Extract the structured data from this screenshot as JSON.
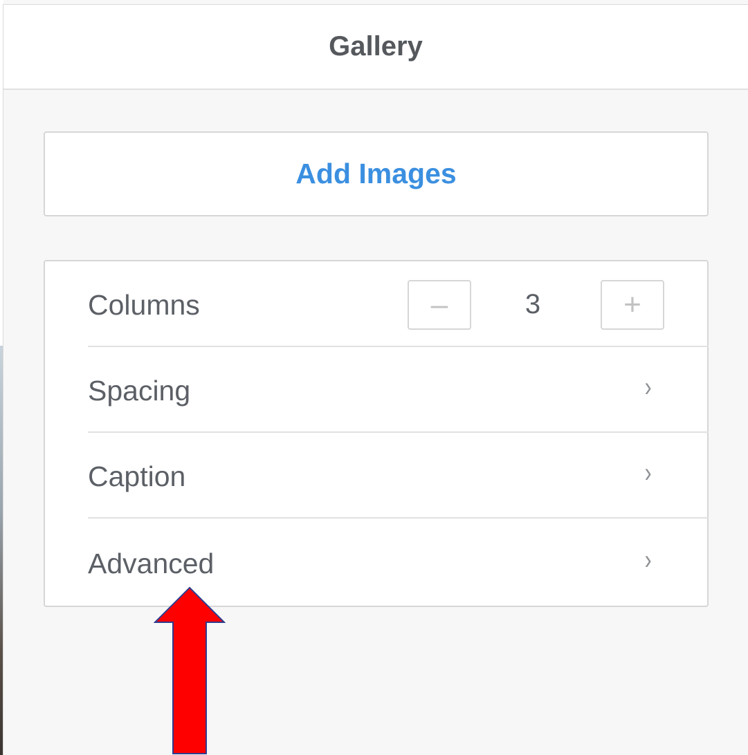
{
  "panel": {
    "title": "Gallery"
  },
  "add_images": {
    "label": "Add Images"
  },
  "settings": {
    "columns": {
      "label": "Columns",
      "decrement_symbol": "–",
      "value": "3",
      "increment_symbol": "+"
    },
    "spacing": {
      "label": "Spacing",
      "chevron": "›"
    },
    "caption": {
      "label": "Caption",
      "chevron": "›"
    },
    "advanced": {
      "label": "Advanced",
      "chevron": "›"
    }
  },
  "annotation": {
    "arrow_color": "#ff0000",
    "arrow_outline": "#2e3d8f"
  },
  "colors": {
    "accent": "#3b8fe0",
    "text": "#5c6066",
    "background": "#f7f7f7"
  }
}
